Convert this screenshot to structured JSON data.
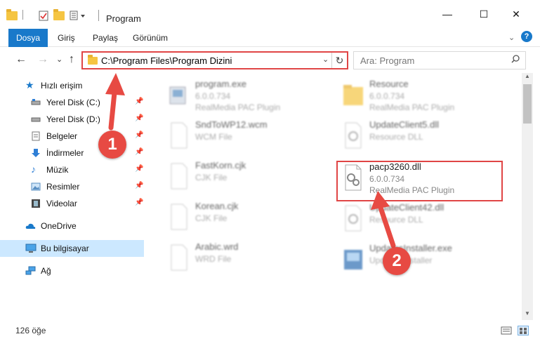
{
  "window": {
    "title": "Program",
    "minimize": "—",
    "maximize": "☐",
    "close": "✕"
  },
  "ribbon": {
    "tabs": [
      "Dosya",
      "Giriş",
      "Paylaş",
      "Görünüm"
    ],
    "help": "?"
  },
  "nav": {
    "address": "C:\\Program Files\\Program Dizini",
    "search_placeholder": "Ara: Program",
    "back": "←",
    "forward": "→",
    "recent": "⌄",
    "up": "↑"
  },
  "sidebar": {
    "quick_access": "Hızlı erişim",
    "items": [
      {
        "label": "Yerel Disk (C:)"
      },
      {
        "label": "Yerel Disk (D:)"
      },
      {
        "label": "Belgeler"
      },
      {
        "label": "İndirmeler"
      },
      {
        "label": "Müzik"
      },
      {
        "label": "Resimler"
      },
      {
        "label": "Videolar"
      }
    ],
    "onedrive": "OneDrive",
    "this_pc": "Bu bilgisayar",
    "network": "Ağ"
  },
  "files": [
    {
      "name": "program.exe",
      "line1": "6.0.0.734",
      "line2": "RealMedia PAC Plugin"
    },
    {
      "name": "Resource",
      "line1": "6.0.0.734",
      "line2": "RealMedia PAC Plugin"
    },
    {
      "name": "SndToWP12.wcm",
      "line1": "WCM File",
      "line2": ""
    },
    {
      "name": "UpdateClient5.dll",
      "line1": "Resource DLL",
      "line2": ""
    },
    {
      "name": "FastKorn.cjk",
      "line1": "CJK File",
      "line2": ""
    },
    {
      "name": "pacp3260.dll",
      "line1": "6.0.0.734",
      "line2": "RealMedia PAC Plugin"
    },
    {
      "name": "Korean.cjk",
      "line1": "CJK File",
      "line2": ""
    },
    {
      "name": "UpdateClient42.dll",
      "line1": "Resource DLL",
      "line2": ""
    },
    {
      "name": "Arabic.wrd",
      "line1": "WRD File",
      "line2": ""
    },
    {
      "name": "UpdatesInstaller.exe",
      "line1": "Updates installer",
      "line2": ""
    }
  ],
  "status": {
    "count": "126 öğe"
  },
  "annotations": {
    "step1": "1",
    "step2": "2"
  },
  "colors": {
    "accent": "#1979ca",
    "highlight": "#e04545",
    "badge": "#e74a43",
    "selected": "#cce8ff"
  }
}
